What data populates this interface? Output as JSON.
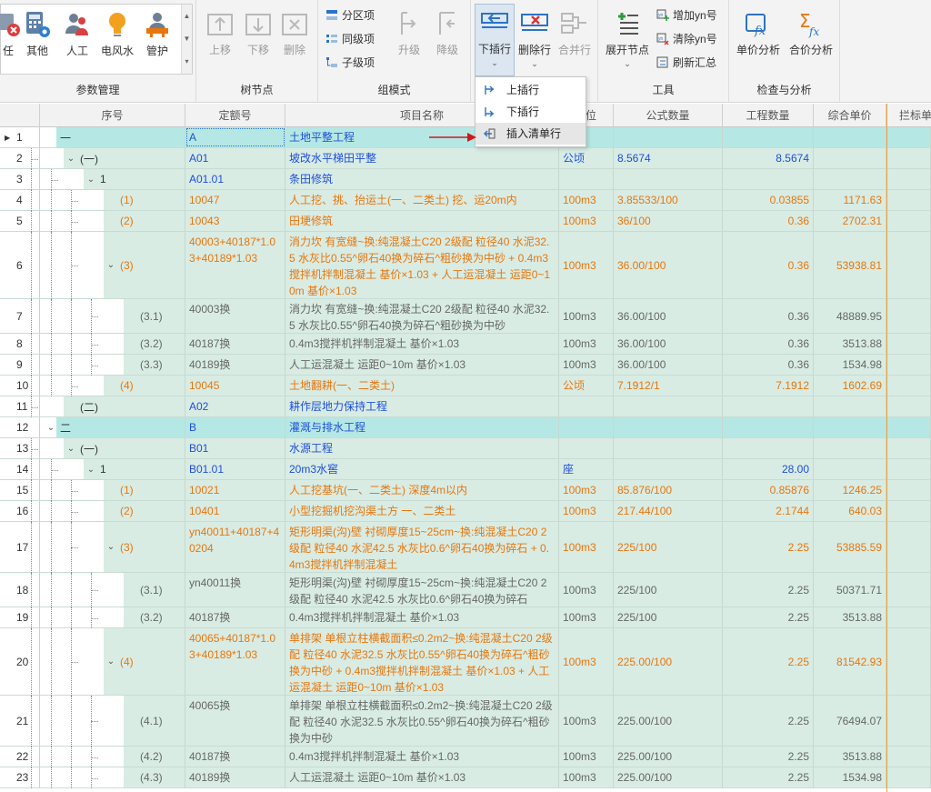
{
  "ribbon": {
    "param_group": {
      "label": "参数管理",
      "buttons": [
        {
          "label": "任",
          "icon": "mgr-icon"
        },
        {
          "label": "其他",
          "icon": "calculator-gear-icon"
        },
        {
          "label": "人工",
          "icon": "people-icon"
        },
        {
          "label": "电风水",
          "icon": "bulb-icon"
        },
        {
          "label": "管护",
          "icon": "worker-icon"
        }
      ]
    },
    "tree_group": {
      "label": "树节点",
      "buttons": [
        {
          "label": "上移",
          "icon": "move-up-icon"
        },
        {
          "label": "下移",
          "icon": "move-down-icon"
        },
        {
          "label": "删除",
          "icon": "delete-node-icon"
        }
      ]
    },
    "mode_group": {
      "label": "组模式",
      "small": [
        "分区项",
        "同级项",
        "子级项"
      ],
      "buttons": [
        {
          "label": "升级",
          "icon": "upgrade-icon"
        },
        {
          "label": "降级",
          "icon": "downgrade-icon"
        }
      ]
    },
    "row_group": {
      "buttons": [
        {
          "label": "下插行",
          "icon": "insert-row-icon"
        },
        {
          "label": "删除行",
          "icon": "delete-row-icon"
        },
        {
          "label": "合并行",
          "icon": "merge-row-icon"
        }
      ]
    },
    "tools_group": {
      "label": "工具",
      "expand_label": "展开节点",
      "small": [
        "增加yn号",
        "清除yn号",
        "刷新汇总"
      ]
    },
    "check_group": {
      "label": "检查与分析",
      "buttons": [
        {
          "label": "单价分析",
          "icon": "unit-price-fx-icon"
        },
        {
          "label": "合价分析",
          "icon": "total-price-sigma-icon"
        }
      ]
    }
  },
  "dropdown": {
    "items": [
      "上插行",
      "下插行",
      "插入清单行"
    ]
  },
  "colors": {
    "blue": "#1f4fd8",
    "orange": "#e8760c",
    "gray": "#666666",
    "row_bg": "#d8ece4",
    "top_bg": "#b5e8e4",
    "accent": "#2b74c7"
  },
  "grid": {
    "headers": [
      "序号",
      "定额号",
      "项目名称",
      "位",
      "公式数量",
      "工程数量",
      "综合单价",
      "拦标单"
    ],
    "rows": [
      {
        "n": "1",
        "ptr": true,
        "lvl": 0,
        "tog": "",
        "seq": "一",
        "code": "A",
        "name": "土地平整工程",
        "unit": "",
        "formula": "",
        "qty": "",
        "price": "",
        "style": "top"
      },
      {
        "n": "2",
        "lvl": 1,
        "tog": "v",
        "seq": "(一)",
        "code": "A01",
        "name": "坡改水平梯田平整",
        "unit": "公顷",
        "formula": "8.5674",
        "qty": "8.5674",
        "price": "",
        "style": "blue"
      },
      {
        "n": "3",
        "lvl": 2,
        "tog": "v",
        "seq": "1",
        "code": "A01.01",
        "name": "条田修筑",
        "unit": "",
        "formula": "",
        "qty": "",
        "price": "",
        "style": "blue"
      },
      {
        "n": "4",
        "lvl": 3,
        "tog": "",
        "seq": "(1)",
        "code": "10047",
        "name": "人工挖、挑、抬运土(一、二类土) 挖、运20m内",
        "unit": "100m3",
        "formula": "3.85533/100",
        "qty": "0.03855",
        "price": "1171.63",
        "style": "orange"
      },
      {
        "n": "5",
        "lvl": 3,
        "tog": "",
        "seq": "(2)",
        "code": "10043",
        "name": "田埂修筑",
        "unit": "100m3",
        "formula": "36/100",
        "qty": "0.36",
        "price": "2702.31",
        "style": "orange"
      },
      {
        "n": "6",
        "lvl": 3,
        "tog": "v",
        "seq": "(3)",
        "code": "40003+40187*1.03+40189*1.03",
        "name": "消力坎 有宽缝~换:纯混凝土C20 2级配 粒径40 水泥32.5 水灰比0.55^卵石40换为碎石^粗砂换为中砂 + 0.4m3搅拌机拌制混凝土 基价×1.03 + 人工运混凝土 运距0~10m 基价×1.03",
        "unit": "100m3",
        "formula": "36.00/100",
        "qty": "0.36",
        "price": "53938.81",
        "style": "orange"
      },
      {
        "n": "7",
        "lvl": 4,
        "tog": "",
        "seq": "(3.1)",
        "code": "40003换",
        "name": "消力坎 有宽缝~换:纯混凝土C20 2级配 粒径40 水泥32.5 水灰比0.55^卵石40换为碎石^粗砂换为中砂",
        "unit": "100m3",
        "formula": "36.00/100",
        "qty": "0.36",
        "price": "48889.95",
        "style": "gray"
      },
      {
        "n": "8",
        "lvl": 4,
        "tog": "",
        "seq": "(3.2)",
        "code": "40187换",
        "name": "0.4m3搅拌机拌制混凝土 基价×1.03",
        "unit": "100m3",
        "formula": "36.00/100",
        "qty": "0.36",
        "price": "3513.88",
        "style": "gray"
      },
      {
        "n": "9",
        "lvl": 4,
        "tog": "",
        "seq": "(3.3)",
        "code": "40189换",
        "name": "人工运混凝土 运距0~10m 基价×1.03",
        "unit": "100m3",
        "formula": "36.00/100",
        "qty": "0.36",
        "price": "1534.98",
        "style": "gray"
      },
      {
        "n": "10",
        "lvl": 3,
        "tog": "",
        "seq": "(4)",
        "code": "10045",
        "name": "土地翻耕(一、二类土)",
        "unit": "公顷",
        "formula": "7.1912/1",
        "qty": "7.1912",
        "price": "1602.69",
        "style": "orange"
      },
      {
        "n": "11",
        "lvl": 1,
        "tog": "",
        "seq": "(二)",
        "code": "A02",
        "name": "耕作层地力保持工程",
        "unit": "",
        "formula": "",
        "qty": "",
        "price": "",
        "style": "blue"
      },
      {
        "n": "12",
        "lvl": 0,
        "tog": "v",
        "seq": "二",
        "code": "B",
        "name": "灌溉与排水工程",
        "unit": "",
        "formula": "",
        "qty": "",
        "price": "",
        "style": "top"
      },
      {
        "n": "13",
        "lvl": 1,
        "tog": "v",
        "seq": "(一)",
        "code": "B01",
        "name": "水源工程",
        "unit": "",
        "formula": "",
        "qty": "",
        "price": "",
        "style": "blue"
      },
      {
        "n": "14",
        "lvl": 2,
        "tog": "v",
        "seq": "1",
        "code": "B01.01",
        "name": "20m3水窖",
        "unit": "座",
        "formula": "",
        "qty": "28.00",
        "price": "",
        "style": "blue"
      },
      {
        "n": "15",
        "lvl": 3,
        "tog": "",
        "seq": "(1)",
        "code": "10021",
        "name": "人工挖基坑(一、二类土) 深度4m以内",
        "unit": "100m3",
        "formula": "85.876/100",
        "qty": "0.85876",
        "price": "1246.25",
        "style": "orange"
      },
      {
        "n": "16",
        "lvl": 3,
        "tog": "",
        "seq": "(2)",
        "code": "10401",
        "name": "小型挖掘机挖沟渠土方 一、二类土",
        "unit": "100m3",
        "formula": "217.44/100",
        "qty": "2.1744",
        "price": "640.03",
        "style": "orange"
      },
      {
        "n": "17",
        "lvl": 3,
        "tog": "v",
        "seq": "(3)",
        "code": "yn40011+40187+40204",
        "name": "矩形明渠(沟)壁 衬砌厚度15~25cm~换:纯混凝土C20 2级配 粒径40 水泥42.5 水灰比0.6^卵石40换为碎石 + 0.4m3搅拌机拌制混凝土",
        "unit": "100m3",
        "formula": "225/100",
        "qty": "2.25",
        "price": "53885.59",
        "style": "orange"
      },
      {
        "n": "18",
        "lvl": 4,
        "tog": "",
        "seq": "(3.1)",
        "code": "yn40011换",
        "name": "矩形明渠(沟)壁 衬砌厚度15~25cm~换:纯混凝土C20 2级配 粒径40 水泥42.5 水灰比0.6^卵石40换为碎石",
        "unit": "100m3",
        "formula": "225/100",
        "qty": "2.25",
        "price": "50371.71",
        "style": "gray"
      },
      {
        "n": "19",
        "lvl": 4,
        "tog": "",
        "seq": "(3.2)",
        "code": "40187换",
        "name": "0.4m3搅拌机拌制混凝土 基价×1.03",
        "unit": "100m3",
        "formula": "225/100",
        "qty": "2.25",
        "price": "3513.88",
        "style": "gray"
      },
      {
        "n": "20",
        "lvl": 3,
        "tog": "v",
        "seq": "(4)",
        "code": "40065+40187*1.03+40189*1.03",
        "name": "单排架 单根立柱横截面积≤0.2m2~换:纯混凝土C20 2级配 粒径40 水泥32.5 水灰比0.55^卵石40换为碎石^粗砂换为中砂 + 0.4m3搅拌机拌制混凝土 基价×1.03 + 人工运混凝土 运距0~10m 基价×1.03",
        "unit": "100m3",
        "formula": "225.00/100",
        "qty": "2.25",
        "price": "81542.93",
        "style": "orange"
      },
      {
        "n": "21",
        "lvl": 4,
        "tog": "",
        "seq": "(4.1)",
        "code": "40065换",
        "name": "单排架 单根立柱横截面积≤0.2m2~换:纯混凝土C20 2级配 粒径40 水泥32.5 水灰比0.55^卵石40换为碎石^粗砂换为中砂",
        "unit": "100m3",
        "formula": "225.00/100",
        "qty": "2.25",
        "price": "76494.07",
        "style": "gray"
      },
      {
        "n": "22",
        "lvl": 4,
        "tog": "",
        "seq": "(4.2)",
        "code": "40187换",
        "name": "0.4m3搅拌机拌制混凝土 基价×1.03",
        "unit": "100m3",
        "formula": "225.00/100",
        "qty": "2.25",
        "price": "3513.88",
        "style": "gray"
      },
      {
        "n": "23",
        "lvl": 4,
        "tog": "",
        "seq": "(4.3)",
        "code": "40189换",
        "name": "人工运混凝土 运距0~10m 基价×1.03",
        "unit": "100m3",
        "formula": "225.00/100",
        "qty": "2.25",
        "price": "1534.98",
        "style": "gray"
      }
    ]
  }
}
